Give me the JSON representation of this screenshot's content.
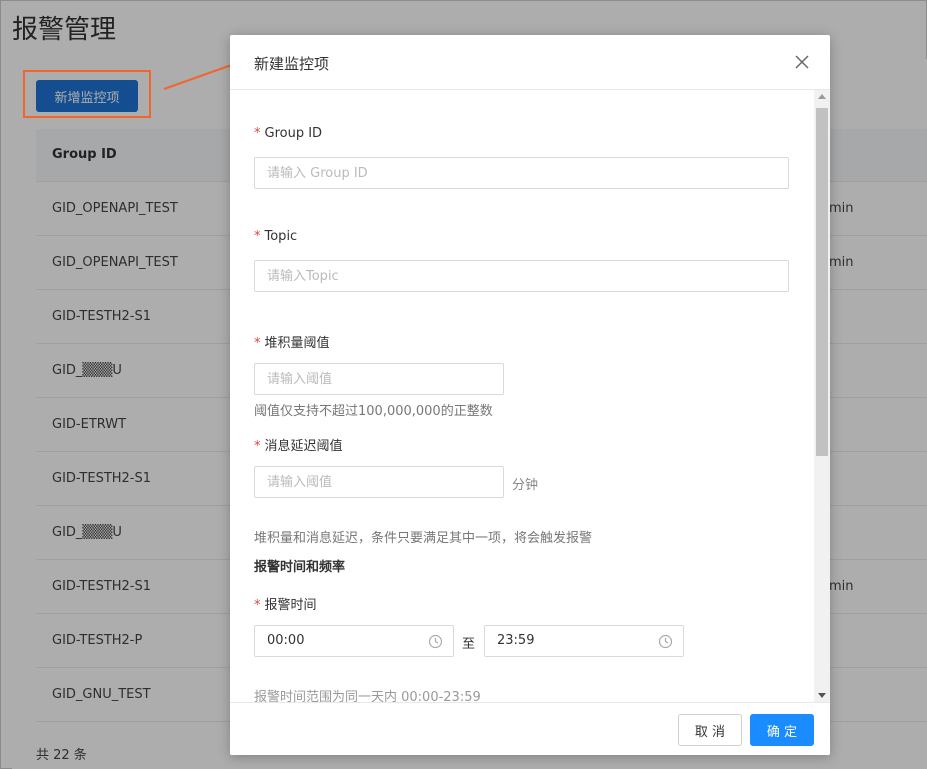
{
  "page": {
    "title": "报警管理",
    "add_button_label": "新增监控项",
    "table": {
      "header_group_id": "Group ID",
      "rows": [
        {
          "gid": "GID_OPENAPI_TEST",
          "right": "min"
        },
        {
          "gid": "GID_OPENAPI_TEST",
          "right": "min"
        },
        {
          "gid": "GID-TESTH2-S1",
          "right": ""
        },
        {
          "gid": "GID_▒▒▒U",
          "right": ""
        },
        {
          "gid": "GID-ETRWT",
          "right": ""
        },
        {
          "gid": "GID-TESTH2-S1",
          "right": ""
        },
        {
          "gid": "GID_▒▒▒U",
          "right": ""
        },
        {
          "gid": "GID-TESTH2-S1",
          "right": "min"
        },
        {
          "gid": "GID-TESTH2-P",
          "right": ""
        },
        {
          "gid": "GID_GNU_TEST",
          "right": ""
        }
      ]
    },
    "total": "共 22 条"
  },
  "modal": {
    "title": "新建监控项",
    "group_id": {
      "label": "Group ID",
      "placeholder": "请输入 Group ID"
    },
    "topic": {
      "label": "Topic",
      "placeholder": "请输入Topic"
    },
    "backlog": {
      "label": "堆积量阈值",
      "placeholder": "请输入阈值",
      "hint": "阈值仅支持不超过100,000,000的正整数"
    },
    "delay": {
      "label": "消息延迟阈值",
      "placeholder": "请输入阈值",
      "unit": "分钟"
    },
    "condition_hint": "堆积量和消息延迟，条件只要满足其中一项，将会触发报警",
    "schedule_title": "报警时间和频率",
    "alarm_time": {
      "label": "报警时间",
      "start": "00:00",
      "to": "至",
      "end": "23:59",
      "hint": "报警时间范围为同一天内 00:00-23:59"
    },
    "cancel_label": "取 消",
    "ok_label": "确 定"
  },
  "colors": {
    "primary": "#1a8cff",
    "add_button": "#1f74d4",
    "required": "#e0443a",
    "annotation": "#f0662d"
  }
}
